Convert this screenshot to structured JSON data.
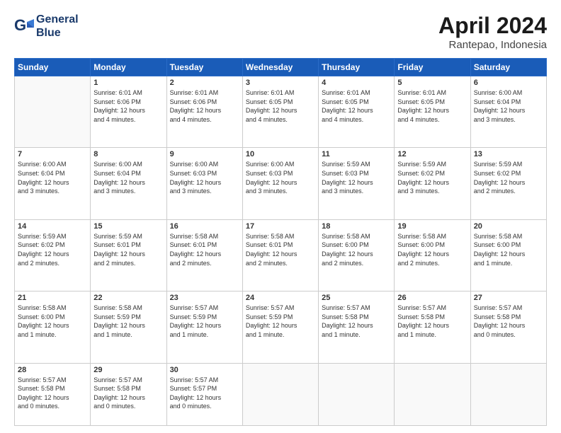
{
  "header": {
    "logo_line1": "General",
    "logo_line2": "Blue",
    "month": "April 2024",
    "location": "Rantepao, Indonesia"
  },
  "weekdays": [
    "Sunday",
    "Monday",
    "Tuesday",
    "Wednesday",
    "Thursday",
    "Friday",
    "Saturday"
  ],
  "weeks": [
    [
      {
        "day": "",
        "info": ""
      },
      {
        "day": "1",
        "info": "Sunrise: 6:01 AM\nSunset: 6:06 PM\nDaylight: 12 hours\nand 4 minutes."
      },
      {
        "day": "2",
        "info": "Sunrise: 6:01 AM\nSunset: 6:06 PM\nDaylight: 12 hours\nand 4 minutes."
      },
      {
        "day": "3",
        "info": "Sunrise: 6:01 AM\nSunset: 6:05 PM\nDaylight: 12 hours\nand 4 minutes."
      },
      {
        "day": "4",
        "info": "Sunrise: 6:01 AM\nSunset: 6:05 PM\nDaylight: 12 hours\nand 4 minutes."
      },
      {
        "day": "5",
        "info": "Sunrise: 6:01 AM\nSunset: 6:05 PM\nDaylight: 12 hours\nand 4 minutes."
      },
      {
        "day": "6",
        "info": "Sunrise: 6:00 AM\nSunset: 6:04 PM\nDaylight: 12 hours\nand 3 minutes."
      }
    ],
    [
      {
        "day": "7",
        "info": "Sunrise: 6:00 AM\nSunset: 6:04 PM\nDaylight: 12 hours\nand 3 minutes."
      },
      {
        "day": "8",
        "info": "Sunrise: 6:00 AM\nSunset: 6:04 PM\nDaylight: 12 hours\nand 3 minutes."
      },
      {
        "day": "9",
        "info": "Sunrise: 6:00 AM\nSunset: 6:03 PM\nDaylight: 12 hours\nand 3 minutes."
      },
      {
        "day": "10",
        "info": "Sunrise: 6:00 AM\nSunset: 6:03 PM\nDaylight: 12 hours\nand 3 minutes."
      },
      {
        "day": "11",
        "info": "Sunrise: 5:59 AM\nSunset: 6:03 PM\nDaylight: 12 hours\nand 3 minutes."
      },
      {
        "day": "12",
        "info": "Sunrise: 5:59 AM\nSunset: 6:02 PM\nDaylight: 12 hours\nand 3 minutes."
      },
      {
        "day": "13",
        "info": "Sunrise: 5:59 AM\nSunset: 6:02 PM\nDaylight: 12 hours\nand 2 minutes."
      }
    ],
    [
      {
        "day": "14",
        "info": "Sunrise: 5:59 AM\nSunset: 6:02 PM\nDaylight: 12 hours\nand 2 minutes."
      },
      {
        "day": "15",
        "info": "Sunrise: 5:59 AM\nSunset: 6:01 PM\nDaylight: 12 hours\nand 2 minutes."
      },
      {
        "day": "16",
        "info": "Sunrise: 5:58 AM\nSunset: 6:01 PM\nDaylight: 12 hours\nand 2 minutes."
      },
      {
        "day": "17",
        "info": "Sunrise: 5:58 AM\nSunset: 6:01 PM\nDaylight: 12 hours\nand 2 minutes."
      },
      {
        "day": "18",
        "info": "Sunrise: 5:58 AM\nSunset: 6:00 PM\nDaylight: 12 hours\nand 2 minutes."
      },
      {
        "day": "19",
        "info": "Sunrise: 5:58 AM\nSunset: 6:00 PM\nDaylight: 12 hours\nand 2 minutes."
      },
      {
        "day": "20",
        "info": "Sunrise: 5:58 AM\nSunset: 6:00 PM\nDaylight: 12 hours\nand 1 minute."
      }
    ],
    [
      {
        "day": "21",
        "info": "Sunrise: 5:58 AM\nSunset: 6:00 PM\nDaylight: 12 hours\nand 1 minute."
      },
      {
        "day": "22",
        "info": "Sunrise: 5:58 AM\nSunset: 5:59 PM\nDaylight: 12 hours\nand 1 minute."
      },
      {
        "day": "23",
        "info": "Sunrise: 5:57 AM\nSunset: 5:59 PM\nDaylight: 12 hours\nand 1 minute."
      },
      {
        "day": "24",
        "info": "Sunrise: 5:57 AM\nSunset: 5:59 PM\nDaylight: 12 hours\nand 1 minute."
      },
      {
        "day": "25",
        "info": "Sunrise: 5:57 AM\nSunset: 5:58 PM\nDaylight: 12 hours\nand 1 minute."
      },
      {
        "day": "26",
        "info": "Sunrise: 5:57 AM\nSunset: 5:58 PM\nDaylight: 12 hours\nand 1 minute."
      },
      {
        "day": "27",
        "info": "Sunrise: 5:57 AM\nSunset: 5:58 PM\nDaylight: 12 hours\nand 0 minutes."
      }
    ],
    [
      {
        "day": "28",
        "info": "Sunrise: 5:57 AM\nSunset: 5:58 PM\nDaylight: 12 hours\nand 0 minutes."
      },
      {
        "day": "29",
        "info": "Sunrise: 5:57 AM\nSunset: 5:58 PM\nDaylight: 12 hours\nand 0 minutes."
      },
      {
        "day": "30",
        "info": "Sunrise: 5:57 AM\nSunset: 5:57 PM\nDaylight: 12 hours\nand 0 minutes."
      },
      {
        "day": "",
        "info": ""
      },
      {
        "day": "",
        "info": ""
      },
      {
        "day": "",
        "info": ""
      },
      {
        "day": "",
        "info": ""
      }
    ]
  ]
}
